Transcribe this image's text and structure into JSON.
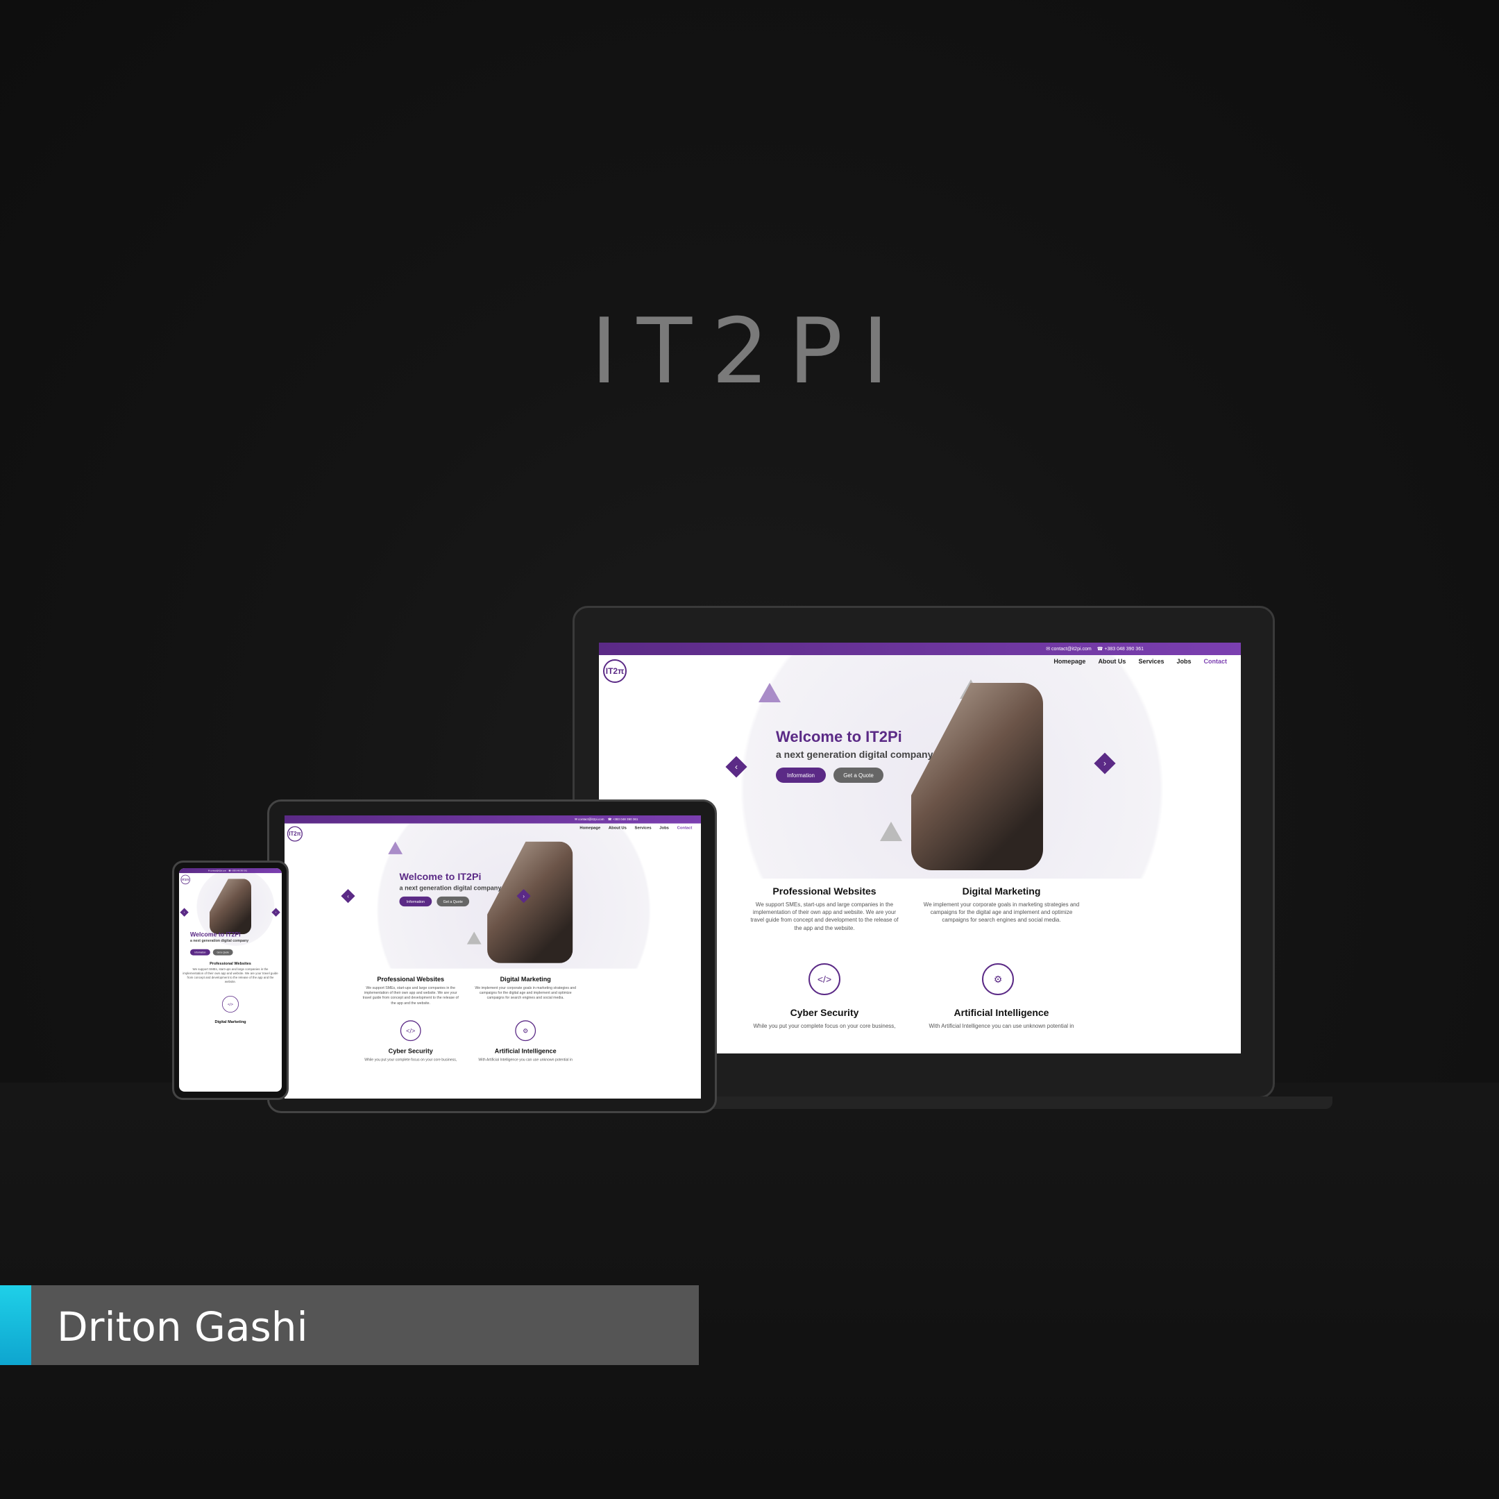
{
  "brand_title": "IT2PI",
  "credit_name": "Driton Gashi",
  "site": {
    "contact_email": "✉ contact@it2pi.com",
    "contact_phone": "☎ +383 048 390 361",
    "logo_text": "IT2π",
    "nav": [
      "Homepage",
      "About Us",
      "Services",
      "Jobs",
      "Contact"
    ],
    "hero_title": "Welcome to IT2Pi",
    "hero_subtitle": "a next generation digital company",
    "btn_info": "Information",
    "btn_quote": "Get a Quote",
    "services": [
      {
        "title": "Professional Websites",
        "text": "We support SMEs, start-ups and large companies in the implementation of their own app and website. We are your travel guide from concept and development to the release of the app and the website."
      },
      {
        "title": "Digital Marketing",
        "text": "We implement your corporate goals in marketing strategies and campaigns for the digital age and implement and optimize campaigns for search engines and social media."
      },
      {
        "title": "Cyber Security",
        "text": "While you put your complete focus on your core business,"
      },
      {
        "title": "Artificial Intelligence",
        "text": "With Artificial Intelligence you can use unknown potential in"
      }
    ]
  },
  "colors": {
    "accent": "#5b2a86",
    "credit_stripe": "#1fd0e8"
  }
}
